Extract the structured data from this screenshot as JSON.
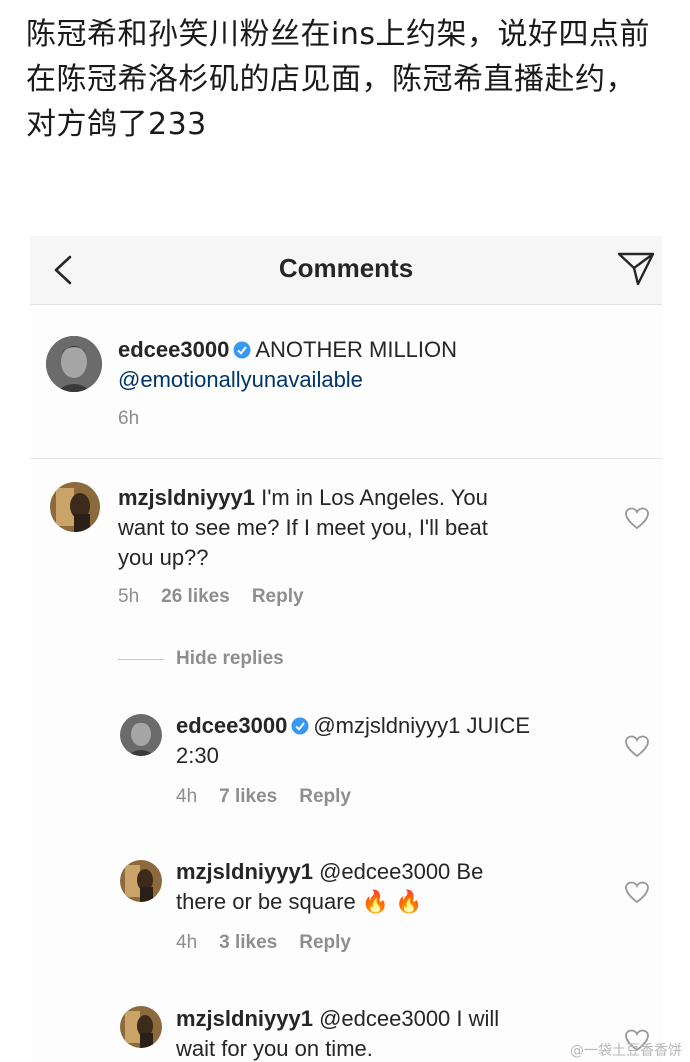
{
  "post": {
    "text": "陈冠希和孙笑川粉丝在ins上约架，说好四点前在陈冠希洛杉矶的店见面，陈冠希直播赴约，对方鸽了233"
  },
  "header": {
    "title": "Comments"
  },
  "comments": [
    {
      "user": "edcee3000",
      "verified": true,
      "text": "ANOTHER MILLION",
      "text2": "@emotionallyunavailable",
      "time": "6h"
    },
    {
      "user": "mzjsldniyyy1",
      "text_line1": "I'm in Los Angeles. You",
      "text_line2": "want to see me? If I meet you, I'll beat",
      "text_line3": "you up??",
      "time": "5h",
      "likes": "26 likes",
      "reply": "Reply",
      "hide_replies": "Hide replies"
    },
    {
      "user": "edcee3000",
      "verified": true,
      "text_line1": "@mzjsldniyyy1 JUICE",
      "text_line2": "2:30",
      "time": "4h",
      "likes": "7 likes",
      "reply": "Reply"
    },
    {
      "user": "mzjsldniyyy1",
      "text_line1": "@edcee3000 Be",
      "text_line2": "there or be square",
      "emoji": "🔥 🔥",
      "time": "4h",
      "likes": "3 likes",
      "reply": "Reply"
    },
    {
      "user": "mzjsldniyyy1",
      "text_line1": "@edcee3000 I will",
      "text_line2": "wait for you on time."
    }
  ],
  "watermark": "@一袋土豆香香饼",
  "icons": {
    "back": "chevron-left-icon",
    "send": "paper-plane-icon",
    "verified": "verified-badge-icon",
    "like": "heart-icon"
  },
  "colors": {
    "verified": "#3897f0",
    "muted": "#8e8e8e",
    "text": "#262626"
  }
}
